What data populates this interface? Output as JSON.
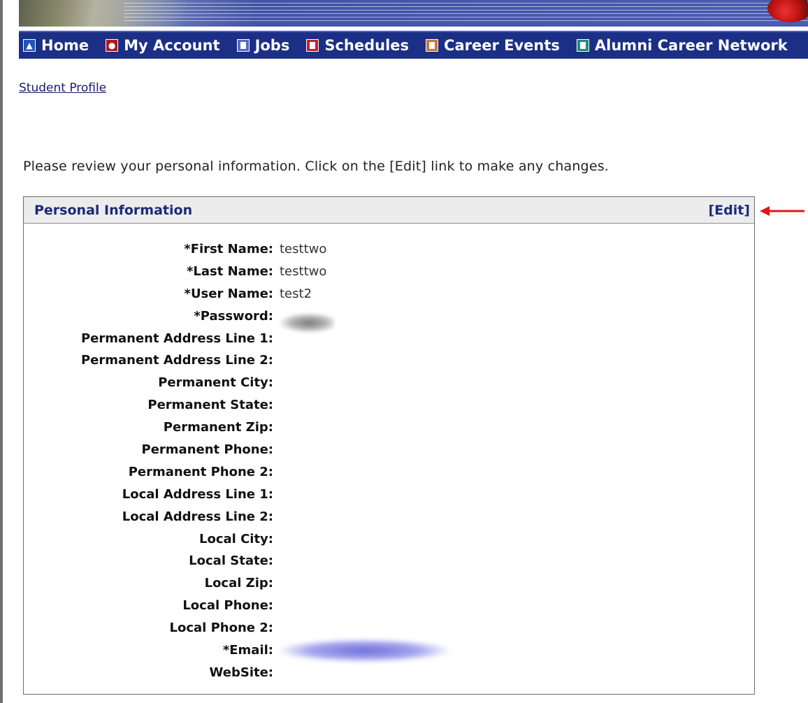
{
  "nav": {
    "items": [
      {
        "label": "Home",
        "icon": "home-icon"
      },
      {
        "label": "My Account",
        "icon": "account-icon"
      },
      {
        "label": "Jobs",
        "icon": "jobs-icon"
      },
      {
        "label": "Schedules",
        "icon": "schedules-icon"
      },
      {
        "label": "Career Events",
        "icon": "career-events-icon"
      },
      {
        "label": "Alumni Career Network",
        "icon": "alumni-icon"
      }
    ]
  },
  "breadcrumb": {
    "student_profile": "Student Profile"
  },
  "intro_text": "Please review your personal information. Click on the [Edit] link to make any changes.",
  "panel": {
    "title": "Personal Information",
    "edit_label": "[Edit]",
    "fields": [
      {
        "label": "*First Name:",
        "value": "testtwo"
      },
      {
        "label": "*Last Name:",
        "value": "testtwo"
      },
      {
        "label": "*User Name:",
        "value": "test2"
      },
      {
        "label": "*Password:",
        "value": ""
      },
      {
        "label": "Permanent Address Line 1:",
        "value": ""
      },
      {
        "label": "Permanent Address Line 2:",
        "value": ""
      },
      {
        "label": "Permanent City:",
        "value": ""
      },
      {
        "label": "Permanent State:",
        "value": ""
      },
      {
        "label": "Permanent Zip:",
        "value": ""
      },
      {
        "label": "Permanent Phone:",
        "value": ""
      },
      {
        "label": "Permanent Phone 2:",
        "value": ""
      },
      {
        "label": "Local Address Line 1:",
        "value": ""
      },
      {
        "label": "Local Address Line 2:",
        "value": ""
      },
      {
        "label": "Local City:",
        "value": ""
      },
      {
        "label": "Local State:",
        "value": ""
      },
      {
        "label": "Local Zip:",
        "value": ""
      },
      {
        "label": "Local Phone:",
        "value": ""
      },
      {
        "label": "Local Phone 2:",
        "value": ""
      },
      {
        "label": "*Email:",
        "value": ""
      },
      {
        "label": "WebSite:",
        "value": ""
      }
    ]
  },
  "colors": {
    "nav_bg": "#1c2f86",
    "heading_text": "#1b2a78",
    "arrow": "#e01818"
  }
}
